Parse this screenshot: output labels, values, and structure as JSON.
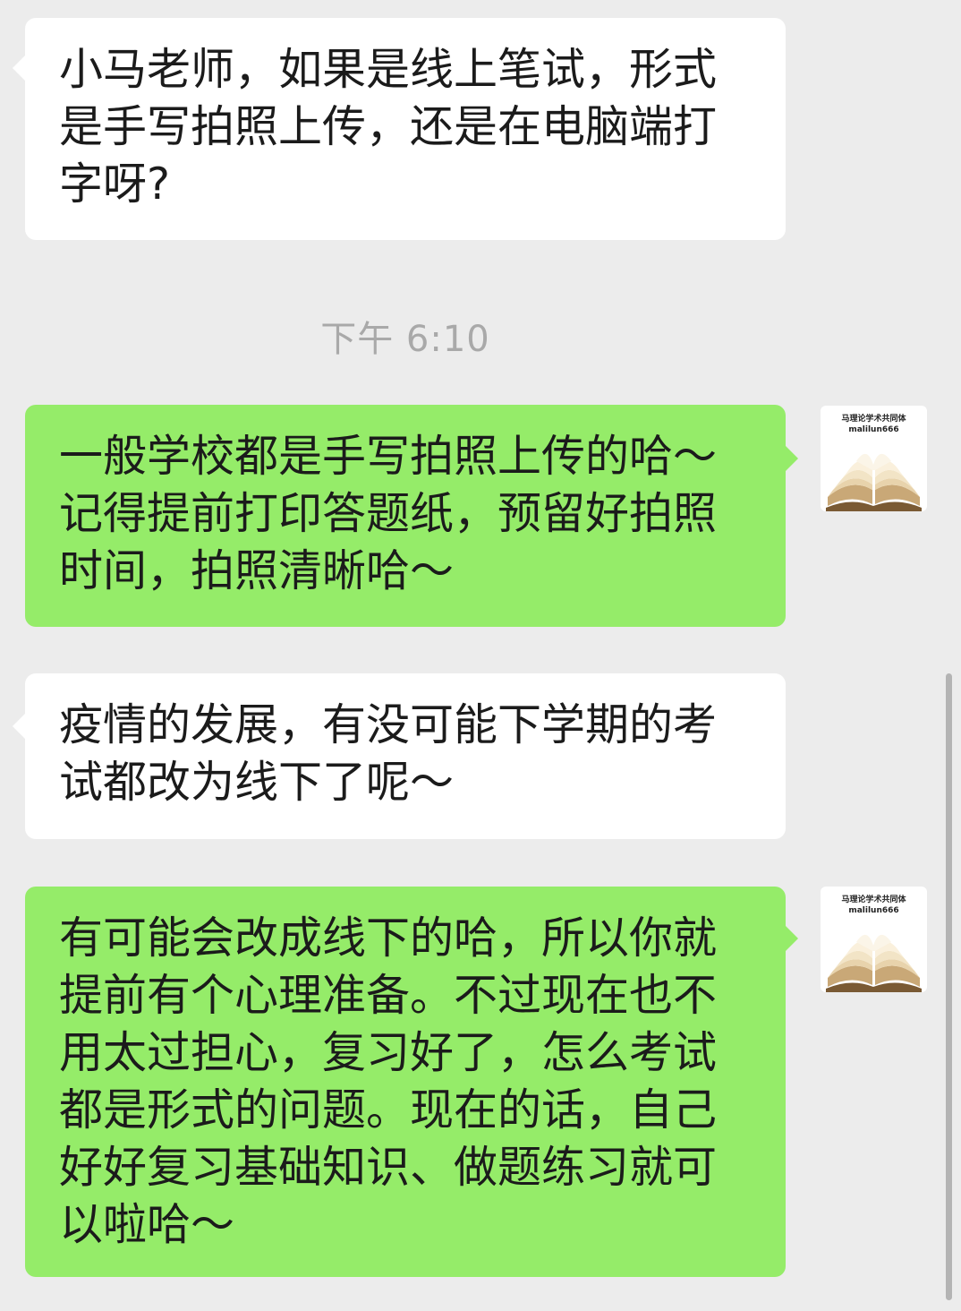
{
  "timestamp": "下午 6:10",
  "messages": [
    {
      "direction": "incoming",
      "text": "小马老师，如果是线上笔试，形式是手写拍照上传，还是在电脑端打字呀?"
    },
    {
      "direction": "outgoing",
      "text": "一般学校都是手写拍照上传的哈～记得提前打印答题纸，预留好拍照时间，拍照清晰哈～"
    },
    {
      "direction": "incoming",
      "text": "疫情的发展，有没可能下学期的考试都改为线下了呢～"
    },
    {
      "direction": "outgoing",
      "text": "有可能会改成线下的哈，所以你就提前有个心理准备。不过现在也不用太过担心，复习好了，怎么考试都是形式的问题。现在的话，自己好好复习基础知识、做题练习就可以啦哈～"
    }
  ],
  "avatar": {
    "title": "马理论学术共同体",
    "subtitle": "malilun666",
    "icon": "open-book-icon"
  },
  "colors": {
    "background": "#ececec",
    "incoming_bubble": "#ffffff",
    "outgoing_bubble": "#95ec69",
    "timestamp_text": "#a9a9a9"
  }
}
